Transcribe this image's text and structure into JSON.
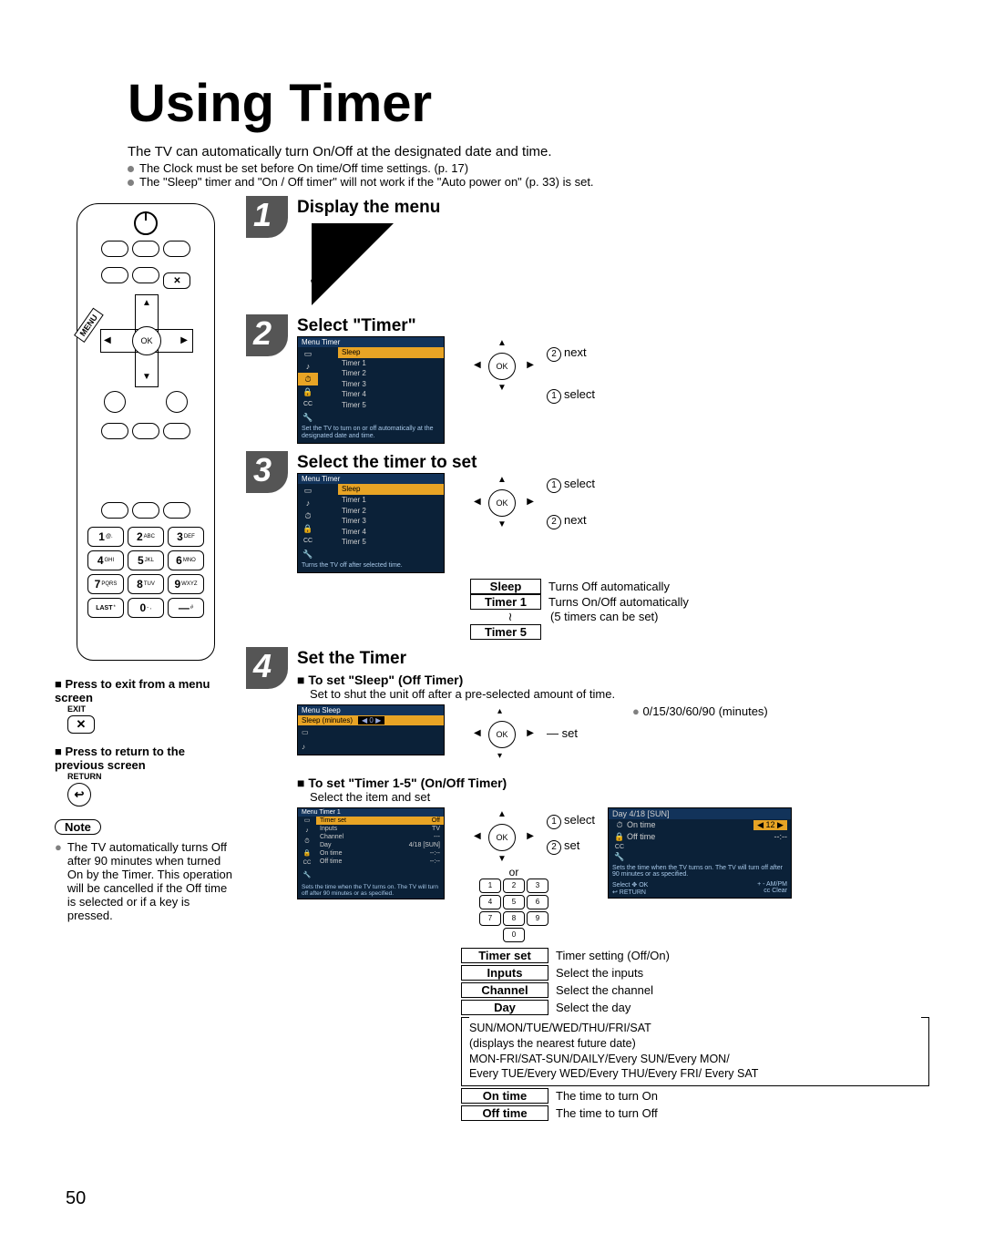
{
  "page_number": "50",
  "title": "Using Timer",
  "intro_line": "The TV can automatically turn On/Off at the designated date and time.",
  "intro_bullets": [
    "The Clock must be set before On time/Off time settings. (p. 17)",
    "The \"Sleep\" timer and \"On / Off timer\" will not work if the \"Auto power on\" (p. 33) is set."
  ],
  "remote": {
    "menu_label": "MENU",
    "ok_label": "OK",
    "keypad": [
      {
        "n": "1",
        "s": "@."
      },
      {
        "n": "2",
        "s": "ABC"
      },
      {
        "n": "3",
        "s": "DEF"
      },
      {
        "n": "4",
        "s": "GHI"
      },
      {
        "n": "5",
        "s": "JKL"
      },
      {
        "n": "6",
        "s": "MNO"
      },
      {
        "n": "7",
        "s": "PQRS"
      },
      {
        "n": "8",
        "s": "TUV"
      },
      {
        "n": "9",
        "s": "WXYZ"
      },
      {
        "n": "LAST",
        "s": "*"
      },
      {
        "n": "0",
        "s": "- ,"
      },
      {
        "n": "—",
        "s": "#"
      }
    ]
  },
  "side": {
    "exit": {
      "heading_prefix": "■ ",
      "heading": "Press to exit from a menu screen",
      "label": "EXIT",
      "glyph": "✕"
    },
    "return": {
      "heading_prefix": "■ ",
      "heading": "Press to return to the previous screen",
      "label": "RETURN",
      "glyph": "↩"
    },
    "note_label": "Note",
    "note_text": "The TV automatically turns Off after 90 minutes when turned On by the Timer. This operation will be cancelled if the Off time is selected or if a key is pressed.",
    "note_bullet_dot": "●"
  },
  "steps": {
    "s1": {
      "num": "1",
      "title": "Display the menu"
    },
    "s2": {
      "num": "2",
      "title": "Select \"Timer\"",
      "menu_path": "Menu    Timer",
      "items": [
        "Sleep",
        "Timer 1",
        "Timer 2",
        "Timer 3",
        "Timer 4",
        "Timer 5"
      ],
      "hint": "Set the TV to turn on or off automatically at the designated date and time.",
      "annot_next": "next",
      "annot_select": "select",
      "ok": "OK"
    },
    "s3": {
      "num": "3",
      "title": "Select the timer to set",
      "menu_path": "Menu    Timer",
      "items": [
        "Sleep",
        "Timer 1",
        "Timer 2",
        "Timer 3",
        "Timer 4",
        "Timer 5"
      ],
      "hint": "Turns the TV off after selected time.",
      "annot_select": "select",
      "annot_next": "next",
      "ok": "OK",
      "rows": [
        {
          "lbl": "Sleep",
          "desc": "Turns Off automatically"
        },
        {
          "lbl": "Timer 1",
          "desc": "Turns On/Off automatically"
        },
        {
          "lbl_gap": "↓",
          "desc": "(5 timers can be set)"
        },
        {
          "lbl": "Timer 5",
          "desc": ""
        }
      ]
    },
    "s4": {
      "num": "4",
      "title": "Set the Timer",
      "sleep": {
        "heading": "■ To set \"Sleep\" (Off Timer)",
        "sub": "Set to shut the unit off after a pre-selected amount of time.",
        "menu_path": "Menu    Sleep",
        "row_label": "Sleep (minutes)",
        "row_value": "0",
        "ok": "OK",
        "annot_set": "set",
        "values": "0/15/30/60/90 (minutes)"
      },
      "timer15": {
        "heading": "■ To set \"Timer 1-5\" (On/Off Timer)",
        "sub": "Select the item and set",
        "menu_path": "Menu    Timer 1",
        "rows": [
          {
            "l": "Timer set",
            "v": "Off"
          },
          {
            "l": "Inputs",
            "v": "TV"
          },
          {
            "l": "Channel",
            "v": "---"
          },
          {
            "l": "Day",
            "v": "4/18 [SUN]"
          },
          {
            "l": "On time",
            "v": "--:--"
          },
          {
            "l": "Off time",
            "v": "--:--"
          }
        ],
        "hint": "Sets the time when the TV turns on. The TV will turn off after 90 minutes or as specified.",
        "ok": "OK",
        "annot_select": "select",
        "annot_set": "set",
        "or_label": "or",
        "mini_keys": [
          "1",
          "2",
          "3",
          "4",
          "5",
          "6",
          "7",
          "8",
          "9",
          "0"
        ],
        "day_popup": {
          "hdr": "Day                    4/18 [SUN]",
          "rows": [
            {
              "icon": "⏱",
              "l": "On time",
              "v": "12",
              "sel": true
            },
            {
              "icon": "🔒",
              "l": "Off time",
              "v": "--:--"
            }
          ],
          "caption": "Sets the time when the TV turns on. The TV will turn off after 90 minutes or as specified.",
          "ok": "OK",
          "return": "RETURN",
          "select": "Select",
          "ampm": "AM/PM",
          "clear": "Clear"
        },
        "defs": [
          {
            "lbl": "Timer set",
            "desc": "Timer setting (Off/On)"
          },
          {
            "lbl": "Inputs",
            "desc": "Select the inputs"
          },
          {
            "lbl": "Channel",
            "desc": "Select the channel"
          },
          {
            "lbl": "Day",
            "desc": "Select the day"
          }
        ],
        "day_values": [
          "SUN/MON/TUE/WED/THU/FRI/SAT",
          "(displays the nearest future date)",
          "MON-FRI/SAT-SUN/DAILY/Every SUN/Every MON/",
          "Every TUE/Every WED/Every THU/Every FRI/ Every SAT"
        ],
        "defs_tail": [
          {
            "lbl": "On time",
            "desc": "The time to turn On"
          },
          {
            "lbl": "Off time",
            "desc": "The time to turn Off"
          }
        ]
      }
    }
  }
}
